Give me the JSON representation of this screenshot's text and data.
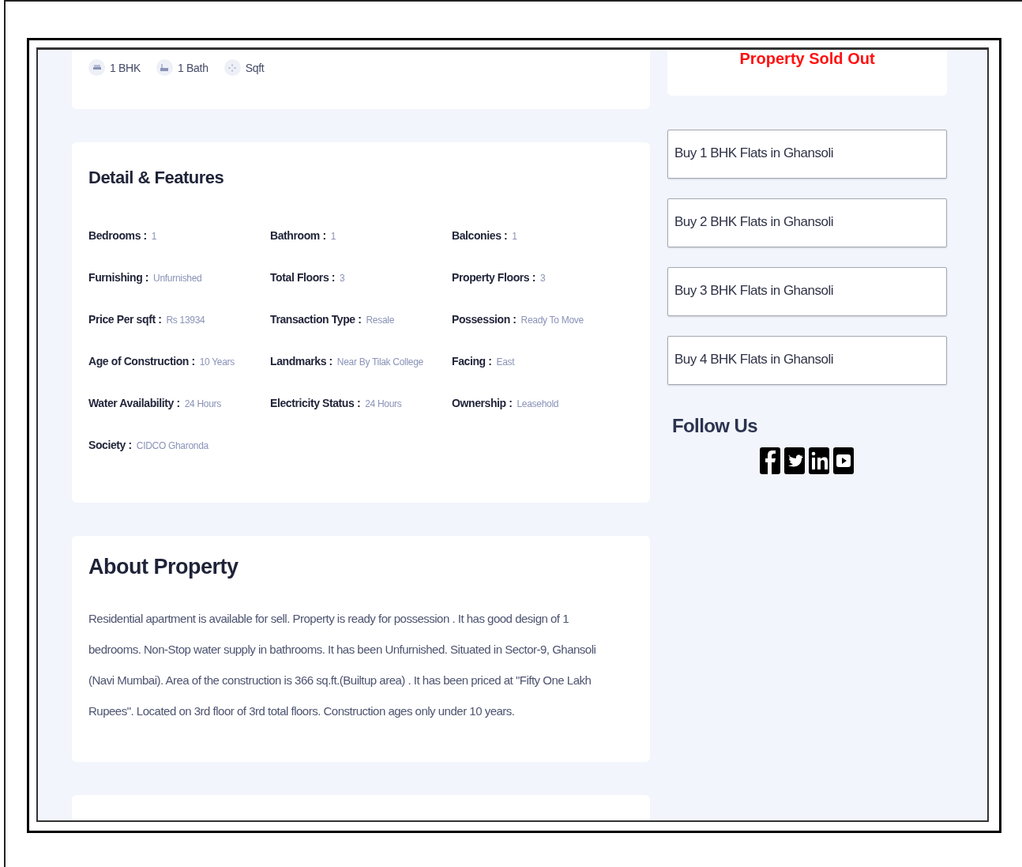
{
  "summary": {
    "specs": [
      {
        "kind": "bed",
        "text": "1 BHK"
      },
      {
        "kind": "bath",
        "text": "1 Bath"
      },
      {
        "kind": "area",
        "text": "Sqft"
      }
    ]
  },
  "sold_banner": {
    "text": "Property Sold Out"
  },
  "details": {
    "title": "Detail & Features",
    "items": [
      {
        "label": "Bedrooms :",
        "value": "1"
      },
      {
        "label": "Bathroom :",
        "value": "1"
      },
      {
        "label": "Balconies :",
        "value": "1"
      },
      {
        "label": "Furnishing :",
        "value": "Unfurnished"
      },
      {
        "label": "Total Floors :",
        "value": "3"
      },
      {
        "label": "Property Floors :",
        "value": "3"
      },
      {
        "label": "Price Per sqft :",
        "value": "Rs 13934"
      },
      {
        "label": "Transaction Type :",
        "value": "Resale"
      },
      {
        "label": "Possession :",
        "value": "Ready To Move"
      },
      {
        "label": "Age of Construction :",
        "value": "10 Years"
      },
      {
        "label": "Landmarks :",
        "value": "Near By Tilak College"
      },
      {
        "label": "Facing :",
        "value": "East"
      },
      {
        "label": "Water Availability :",
        "value": "24 Hours"
      },
      {
        "label": "Electricity Status :",
        "value": "24 Hours"
      },
      {
        "label": "Ownership :",
        "value": "Leasehold"
      },
      {
        "label": "Society :",
        "value": "CIDCO Gharonda"
      }
    ]
  },
  "about": {
    "title": "About Property",
    "text": "Residential apartment is available for sell. Property is ready for possession . It has good design of 1 bedrooms. Non-Stop water supply in bathrooms. It has been Unfurnished. Situated in Sector-9, Ghansoli (Navi Mumbai). Area of the construction is 366 sq.ft.(Builtup area) . It has been priced at \"Fifty One Lakh Rupees\". Located on 3rd floor of 3rd total floors. Construction ages only under 10 years."
  },
  "links": [
    "Buy 1 BHK Flats in Ghansoli",
    "Buy 2 BHK Flats in Ghansoli",
    "Buy 3 BHK Flats in Ghansoli",
    "Buy 4 BHK Flats in Ghansoli"
  ],
  "follow": {
    "title": "Follow Us",
    "icons": [
      {
        "kind": "facebook"
      },
      {
        "kind": "twitter"
      },
      {
        "kind": "linkedin"
      },
      {
        "kind": "youtube"
      }
    ]
  }
}
